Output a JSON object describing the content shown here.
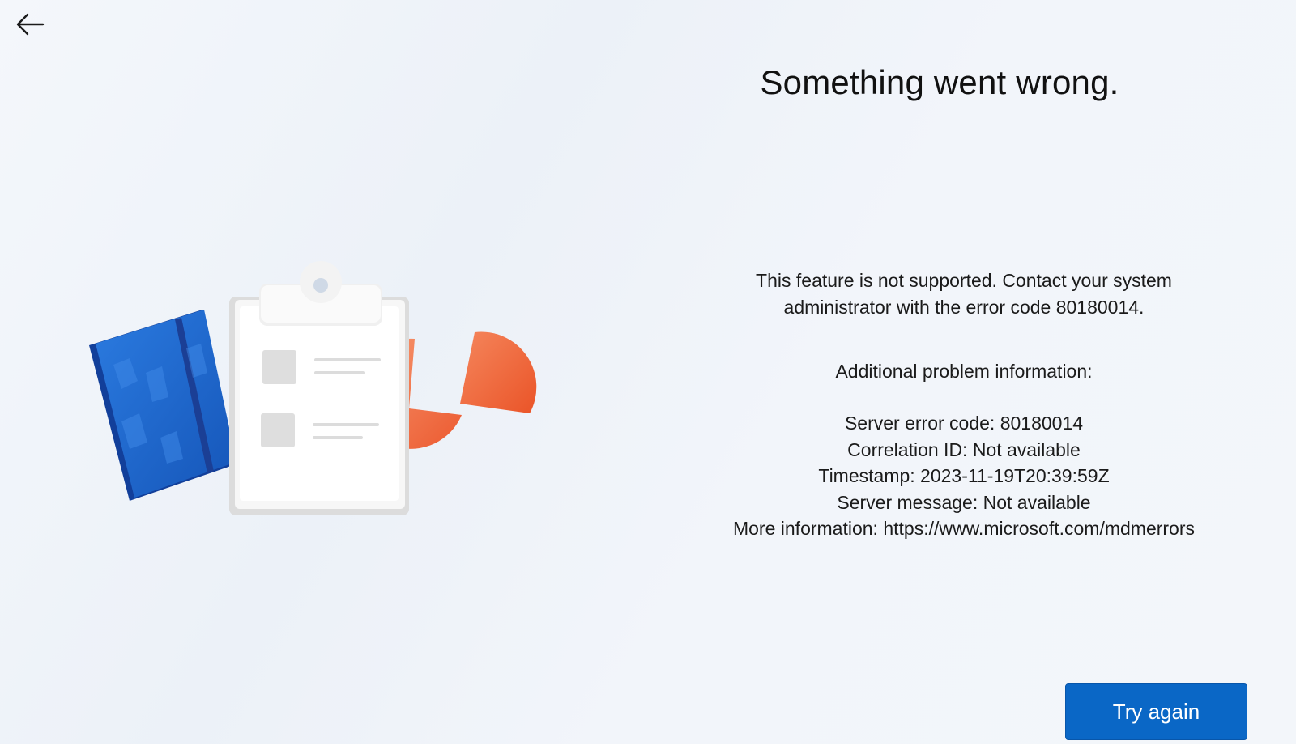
{
  "navigation": {
    "back_icon": "arrow-left-icon"
  },
  "error": {
    "title": "Something went wrong.",
    "message_line1": "This feature is not supported. Contact your system",
    "message_line2": "administrator with the error code 80180014.",
    "info_heading": "Additional problem information:",
    "server_error_code": "Server error code: 80180014",
    "correlation_id": "Correlation ID: Not available",
    "timestamp": "Timestamp: 2023-11-19T20:39:59Z",
    "server_message": "Server message: Not available",
    "more_information": "More information: https://www.microsoft.com/mdmerrors"
  },
  "actions": {
    "try_again_label": "Try again"
  },
  "colors": {
    "accent": "#0a67c6",
    "notebook_blue": "#1c63c8",
    "pie_orange": "#f2693e"
  }
}
